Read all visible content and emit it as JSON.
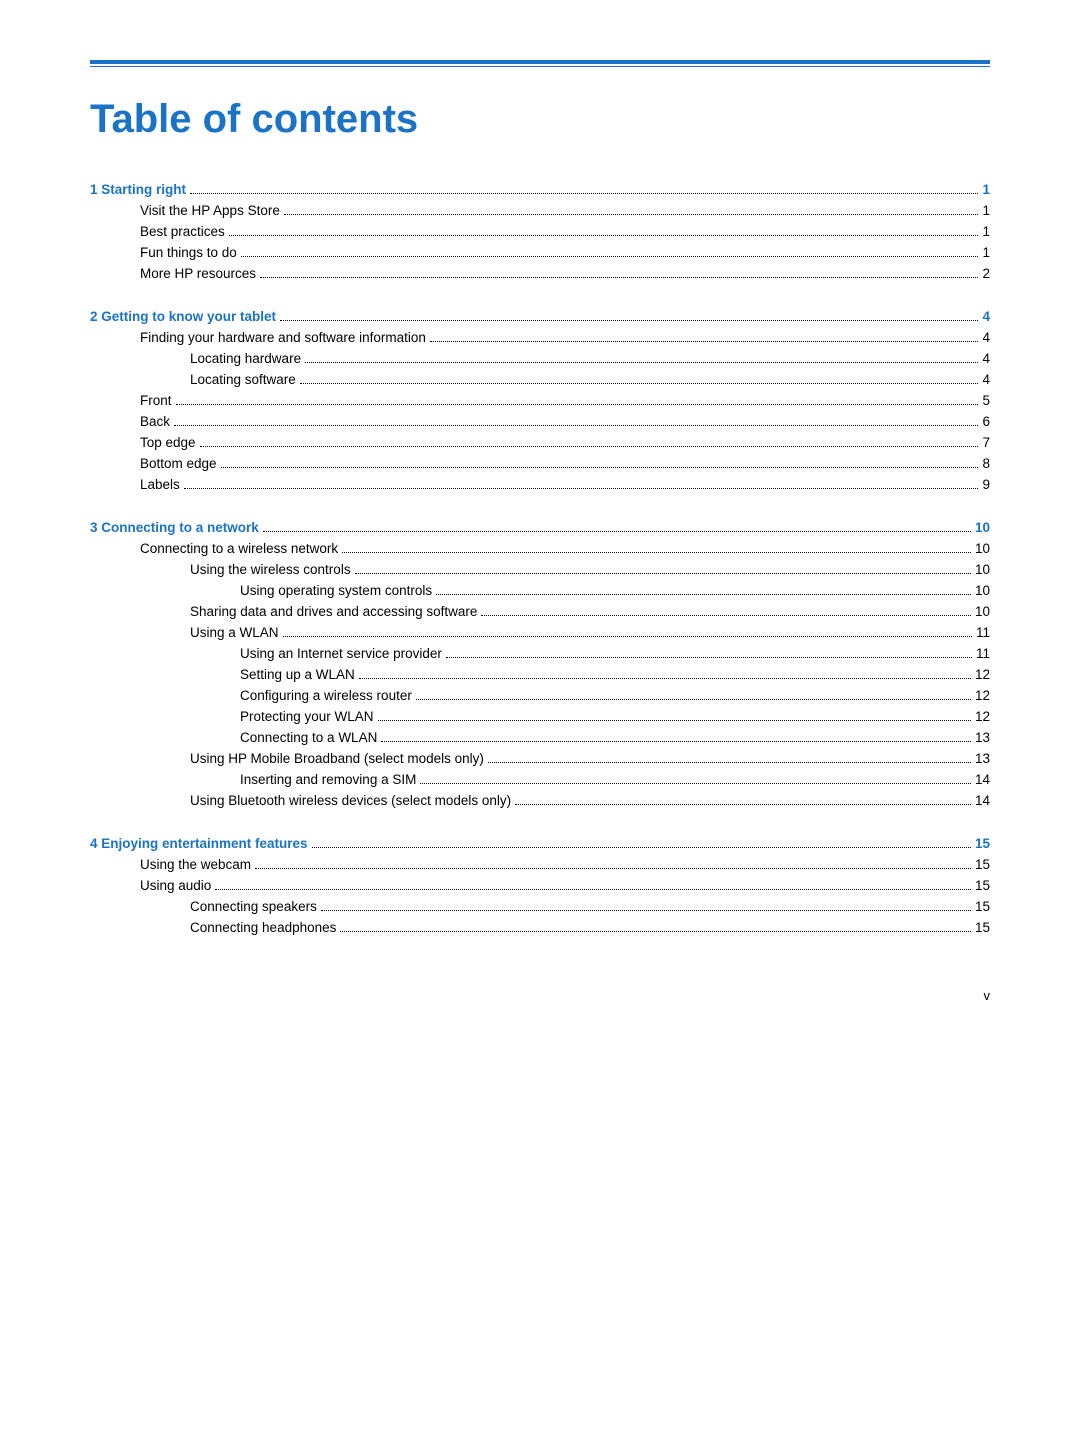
{
  "page": {
    "title": "Table of contents",
    "footer": "v"
  },
  "sections": [
    {
      "id": "section1",
      "header": "1  Starting right",
      "header_page": "1",
      "entries": [
        {
          "indent": 1,
          "text": "Visit the HP Apps Store",
          "page": "1"
        },
        {
          "indent": 1,
          "text": "Best practices",
          "page": "1"
        },
        {
          "indent": 1,
          "text": "Fun things to do",
          "page": "1"
        },
        {
          "indent": 1,
          "text": "More HP resources",
          "page": "2"
        }
      ]
    },
    {
      "id": "section2",
      "header": "2  Getting to know your tablet",
      "header_page": "4",
      "entries": [
        {
          "indent": 1,
          "text": "Finding your hardware and software information",
          "page": "4"
        },
        {
          "indent": 2,
          "text": "Locating hardware",
          "page": "4"
        },
        {
          "indent": 2,
          "text": "Locating software",
          "page": "4"
        },
        {
          "indent": 1,
          "text": "Front",
          "page": "5"
        },
        {
          "indent": 1,
          "text": "Back",
          "page": "6"
        },
        {
          "indent": 1,
          "text": "Top edge",
          "page": "7"
        },
        {
          "indent": 1,
          "text": "Bottom edge",
          "page": "8"
        },
        {
          "indent": 1,
          "text": "Labels",
          "page": "9"
        }
      ]
    },
    {
      "id": "section3",
      "header": "3  Connecting to a network",
      "header_page": "10",
      "entries": [
        {
          "indent": 1,
          "text": "Connecting to a wireless network",
          "page": "10"
        },
        {
          "indent": 2,
          "text": "Using the wireless controls",
          "page": "10"
        },
        {
          "indent": 3,
          "text": "Using operating system controls",
          "page": "10"
        },
        {
          "indent": 2,
          "text": "Sharing data and drives and accessing software",
          "page": "10"
        },
        {
          "indent": 2,
          "text": "Using a WLAN",
          "page": "11"
        },
        {
          "indent": 3,
          "text": "Using an Internet service provider",
          "page": "11"
        },
        {
          "indent": 3,
          "text": "Setting up a WLAN",
          "page": "12"
        },
        {
          "indent": 3,
          "text": "Configuring a wireless router",
          "page": "12"
        },
        {
          "indent": 3,
          "text": "Protecting your WLAN",
          "page": "12"
        },
        {
          "indent": 3,
          "text": "Connecting to a WLAN",
          "page": "13"
        },
        {
          "indent": 2,
          "text": "Using HP Mobile Broadband (select models only)",
          "page": "13"
        },
        {
          "indent": 3,
          "text": "Inserting and removing a SIM",
          "page": "14"
        },
        {
          "indent": 2,
          "text": "Using Bluetooth wireless devices (select models only)",
          "page": "14"
        }
      ]
    },
    {
      "id": "section4",
      "header": "4  Enjoying entertainment features",
      "header_page": "15",
      "entries": [
        {
          "indent": 1,
          "text": "Using the webcam",
          "page": "15"
        },
        {
          "indent": 1,
          "text": "Using audio",
          "page": "15"
        },
        {
          "indent": 2,
          "text": "Connecting speakers",
          "page": "15"
        },
        {
          "indent": 2,
          "text": "Connecting headphones",
          "page": "15"
        }
      ]
    }
  ]
}
